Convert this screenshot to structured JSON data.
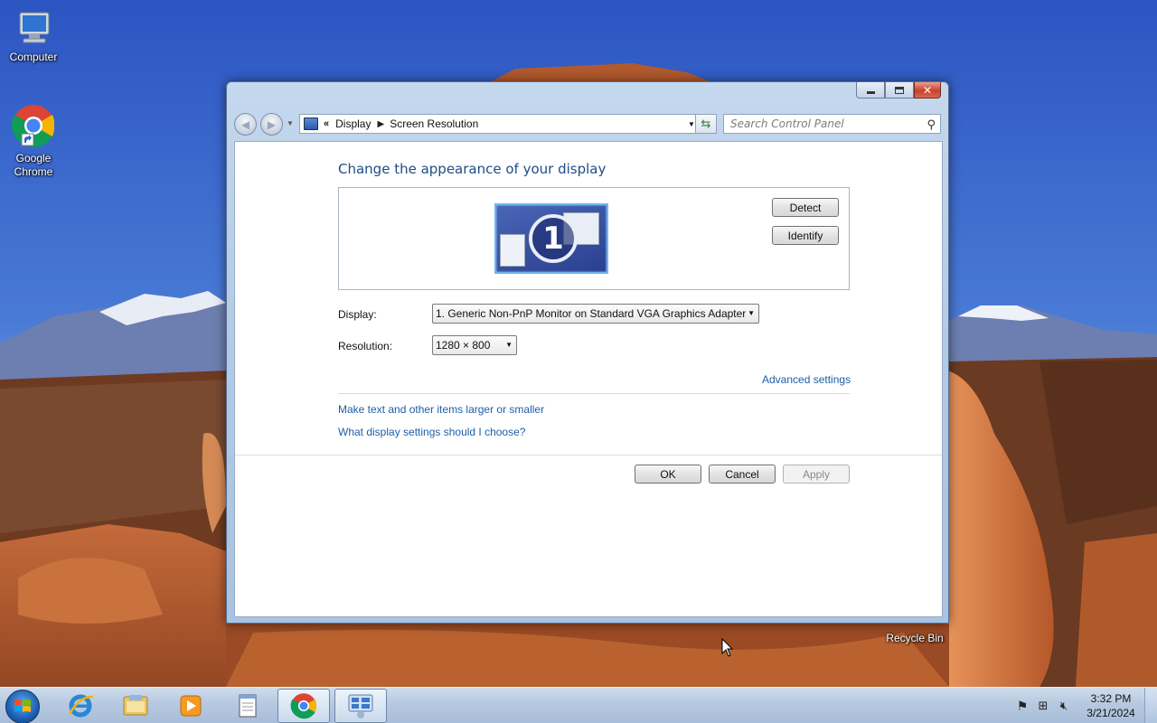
{
  "desktop": {
    "icons": [
      {
        "label": "Computer",
        "icon": "computer-icon"
      },
      {
        "label": "Google Chrome",
        "icon": "chrome-icon"
      },
      {
        "label": "Recycle Bin",
        "icon": "recycle-bin-icon"
      }
    ]
  },
  "window": {
    "caption_buttons": {
      "minimize": "minimize-icon",
      "maximize": "maximize-icon",
      "close": "close-icon"
    },
    "breadcrumb": {
      "overflow": "«",
      "items": [
        "Display",
        "Screen Resolution"
      ]
    },
    "search_placeholder": "Search Control Panel",
    "heading": "Change the appearance of your display",
    "monitor_number": "1",
    "detect_label": "Detect",
    "identify_label": "Identify",
    "display_label": "Display:",
    "display_value": "1. Generic Non-PnP Monitor on Standard VGA Graphics Adapter",
    "resolution_label": "Resolution:",
    "resolution_value": "1280 × 800",
    "advanced_link": "Advanced settings",
    "links": [
      "Make text and other items larger or smaller",
      "What display settings should I choose?"
    ],
    "ok_label": "OK",
    "cancel_label": "Cancel",
    "apply_label": "Apply"
  },
  "taskbar": {
    "apps": [
      "internet-explorer-icon",
      "windows-explorer-icon",
      "media-player-icon",
      "notepad-icon",
      "chrome-icon",
      "control-panel-icon"
    ],
    "tray_icons": [
      "action-center-flag-icon",
      "network-icon",
      "volume-muted-icon"
    ],
    "clock": {
      "time": "3:32 PM",
      "date": "3/21/2024"
    }
  },
  "colors": {
    "link": "#1b5fa8",
    "heading": "#1e4d86",
    "taskbar": "#b6c9e0"
  }
}
